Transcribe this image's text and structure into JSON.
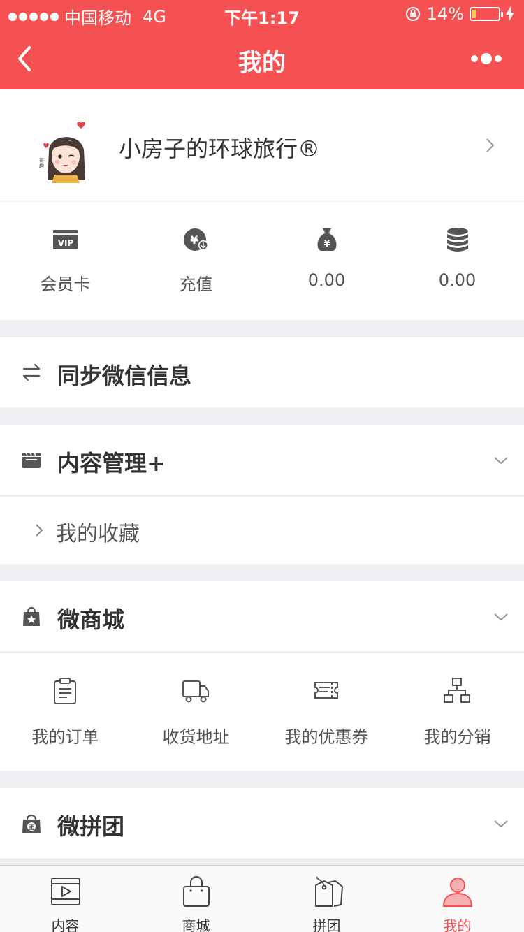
{
  "status_bar": {
    "carrier": "中国移动",
    "network": "4G",
    "time": "下午1:17",
    "battery": "14%",
    "battery_level": 0.14
  },
  "nav": {
    "title": "我的"
  },
  "profile": {
    "username": "小房子的环球旅行®"
  },
  "quick_actions": [
    {
      "label": "会员卡",
      "icon": "vip-card-icon"
    },
    {
      "label": "充值",
      "icon": "recharge-icon"
    },
    {
      "label": "0.00",
      "icon": "money-bag-icon"
    },
    {
      "label": "0.00",
      "icon": "coins-icon"
    }
  ],
  "sync": {
    "label": "同步微信信息"
  },
  "content_mgmt": {
    "label": "内容管理+",
    "sub_items": [
      "我的收藏"
    ]
  },
  "micro_mall": {
    "label": "微商城",
    "items": [
      {
        "label": "我的订单",
        "icon": "order-icon"
      },
      {
        "label": "收货地址",
        "icon": "truck-icon"
      },
      {
        "label": "我的优惠券",
        "icon": "coupon-icon"
      },
      {
        "label": "我的分销",
        "icon": "distribution-icon"
      }
    ]
  },
  "group_buy": {
    "label": "微拼团"
  },
  "tabbar": [
    {
      "label": "内容",
      "icon": "video-icon"
    },
    {
      "label": "商城",
      "icon": "shopping-bag-icon"
    },
    {
      "label": "拼团",
      "icon": "tags-icon"
    },
    {
      "label": "我的",
      "icon": "user-icon",
      "active": true
    }
  ],
  "colors": {
    "accent": "#f55052",
    "background": "#efeff4",
    "icon": "#555555"
  }
}
